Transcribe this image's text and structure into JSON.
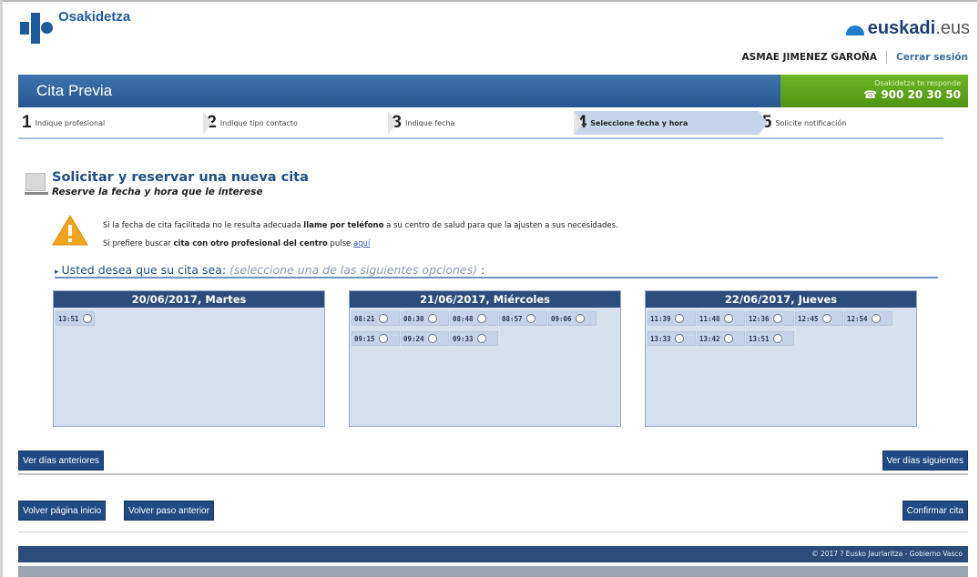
{
  "brand": {
    "logo": "Osakidetza",
    "euskadi_bold": "euskadi",
    "euskadi_tld": ".eus"
  },
  "user": {
    "name": "ASMAE JIMENEZ GAROÑA",
    "logout": "Cerrar sesión"
  },
  "title_bar": {
    "title": "Cita Previa",
    "phone_caption": "Osakidetza te responde",
    "phone": "900 20 30 50"
  },
  "steps": [
    {
      "num": "1",
      "label": "Indique profesional"
    },
    {
      "num": "2",
      "label": "Indique tipo contacto"
    },
    {
      "num": "3",
      "label": "Indique fecha"
    },
    {
      "num": "4",
      "label": "Seleccione fecha y hora"
    },
    {
      "num": "5",
      "label": "Solicite notificación"
    }
  ],
  "active_step": 4,
  "section": {
    "title": "Solicitar y reservar una nueva cita",
    "subtitle": "Reserve la fecha y hora que le interese"
  },
  "warning": {
    "line1_a": "Si la fecha de cita facilitada no le resulta adecuada ",
    "line1_b": "llame por teléfono",
    "line1_c": " a su centro de salud para que la ajusten a sus necesidades.",
    "line2_a": "Si prefiere buscar ",
    "line2_b": "cita con otro profesional del centro",
    "line2_c": " pulse ",
    "line2_link": "aquí"
  },
  "choose": {
    "label": "Usted desea que su cita sea:",
    "hint": "(seleccione una de las siguientes opciones)",
    "colon": " :"
  },
  "days": [
    {
      "header": "20/06/2017, Martes",
      "slots": [
        "13:51"
      ]
    },
    {
      "header": "21/06/2017, Miércoles",
      "slots": [
        "08:21",
        "08:30",
        "08:48",
        "08:57",
        "09:06",
        "09:15",
        "09:24",
        "09:33"
      ]
    },
    {
      "header": "22/06/2017, Jueves",
      "slots": [
        "11:39",
        "11:48",
        "12:36",
        "12:45",
        "12:54",
        "13:33",
        "13:42",
        "13:51"
      ]
    }
  ],
  "buttons": {
    "prev_days": "Ver días anteriores",
    "next_days": "Ver días siguientes",
    "home": "Volver página inicio",
    "back": "Volver paso anterior",
    "confirm": "Confirmar cita"
  },
  "footer": "© 2017 ? Eusko Jaurlaritza - Gobierno Vasco",
  "colors": {
    "primary": "#2c4d7c",
    "accent_green": "#5fa51c",
    "panel_bg": "#d6e0ef"
  }
}
